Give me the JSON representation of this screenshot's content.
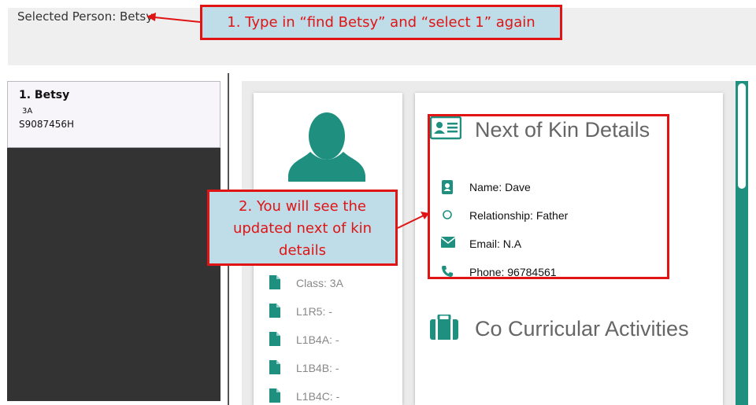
{
  "top_bar": {
    "selected_person": "Selected Person: Betsy"
  },
  "callouts": {
    "step1": "1. Type in “find Betsy” and “select 1” again",
    "step2_lines": [
      "2. You will see the",
      "updated next of kin",
      "details"
    ]
  },
  "person_list": [
    {
      "index_name": "1.  Betsy",
      "class": "3A",
      "id": "S9087456H"
    }
  ],
  "student_details": [
    {
      "label": "Class: 3A",
      "icon": "file-icon"
    },
    {
      "label": "L1R5: -",
      "icon": "file-icon"
    },
    {
      "label": "L1B4A: -",
      "icon": "file-icon"
    },
    {
      "label": "L1B4B: -",
      "icon": "file-icon"
    },
    {
      "label": "L1B4C: -",
      "icon": "file-icon"
    }
  ],
  "next_of_kin": {
    "title": "Next of Kin Details",
    "name": "Name: Dave",
    "relationship": "Relationship: Father",
    "email": "Email: N.A",
    "phone": "Phone: 96784561"
  },
  "cca": {
    "title": "Co Curricular Activities"
  },
  "colors": {
    "accent": "#1f9080",
    "callout_bg": "#bedde8",
    "callout_border": "#e01414",
    "list_bg": "#333333"
  }
}
